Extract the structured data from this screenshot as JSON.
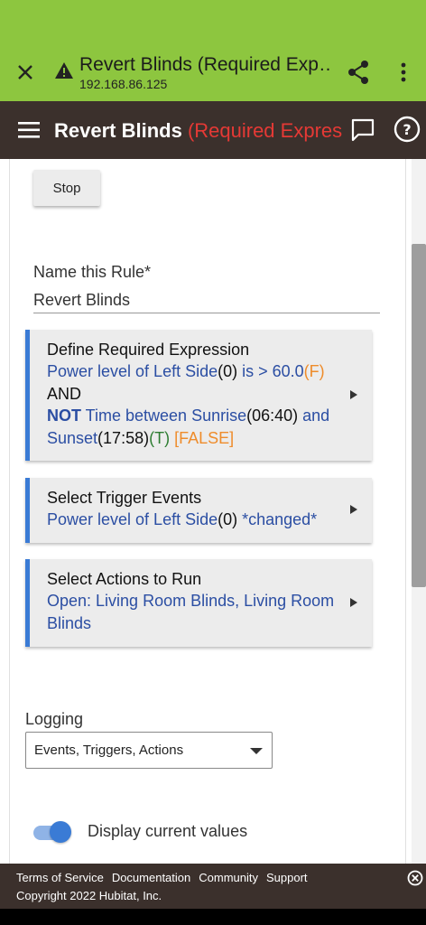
{
  "browser": {
    "title": "Revert Blinds (Required Exp…",
    "url": "192.168.86.125"
  },
  "header": {
    "title_main": "Revert Blinds ",
    "title_red": "(Required Expres"
  },
  "stop_label": "Stop",
  "rule_name": {
    "label": "Name this Rule*",
    "value": "Revert Blinds"
  },
  "required_expression": {
    "heading": "Define Required Expression",
    "line1_a": "Power level of Left Side",
    "line1_b": "(0)",
    "line1_c": " is > 60.0",
    "line1_d": "(F)",
    "line2": "AND",
    "line3_not": "NOT",
    "line3_a": " Time between Sunrise",
    "line3_b": "(06:40)",
    "line3_c": " and",
    "line4_a": "Sunset",
    "line4_b": "(17:58)",
    "line4_c": "(T)",
    "line4_d": " [FALSE]"
  },
  "trigger_events": {
    "heading": "Select Trigger Events",
    "body_a": "Power level of Left Side",
    "body_b": "(0)",
    "body_c": " *changed*"
  },
  "actions": {
    "heading": "Select Actions to Run",
    "body": "Open: Living Room Blinds, Living Room Blinds"
  },
  "logging": {
    "label": "Logging",
    "selected": "Events, Triggers, Actions"
  },
  "display_values": {
    "label": "Display current values",
    "on": true
  },
  "footer": {
    "links": [
      "Terms of Service",
      "Documentation",
      "Community",
      "Support"
    ],
    "copyright": "Copyright 2022 Hubitat, Inc."
  },
  "colors": {
    "browser_bar": "#8dc63f",
    "header": "#3b302c",
    "accent": "#3a7bd5",
    "link_text": "#2b4ea3",
    "orange": "#ee8c2b",
    "red": "#e53935"
  }
}
